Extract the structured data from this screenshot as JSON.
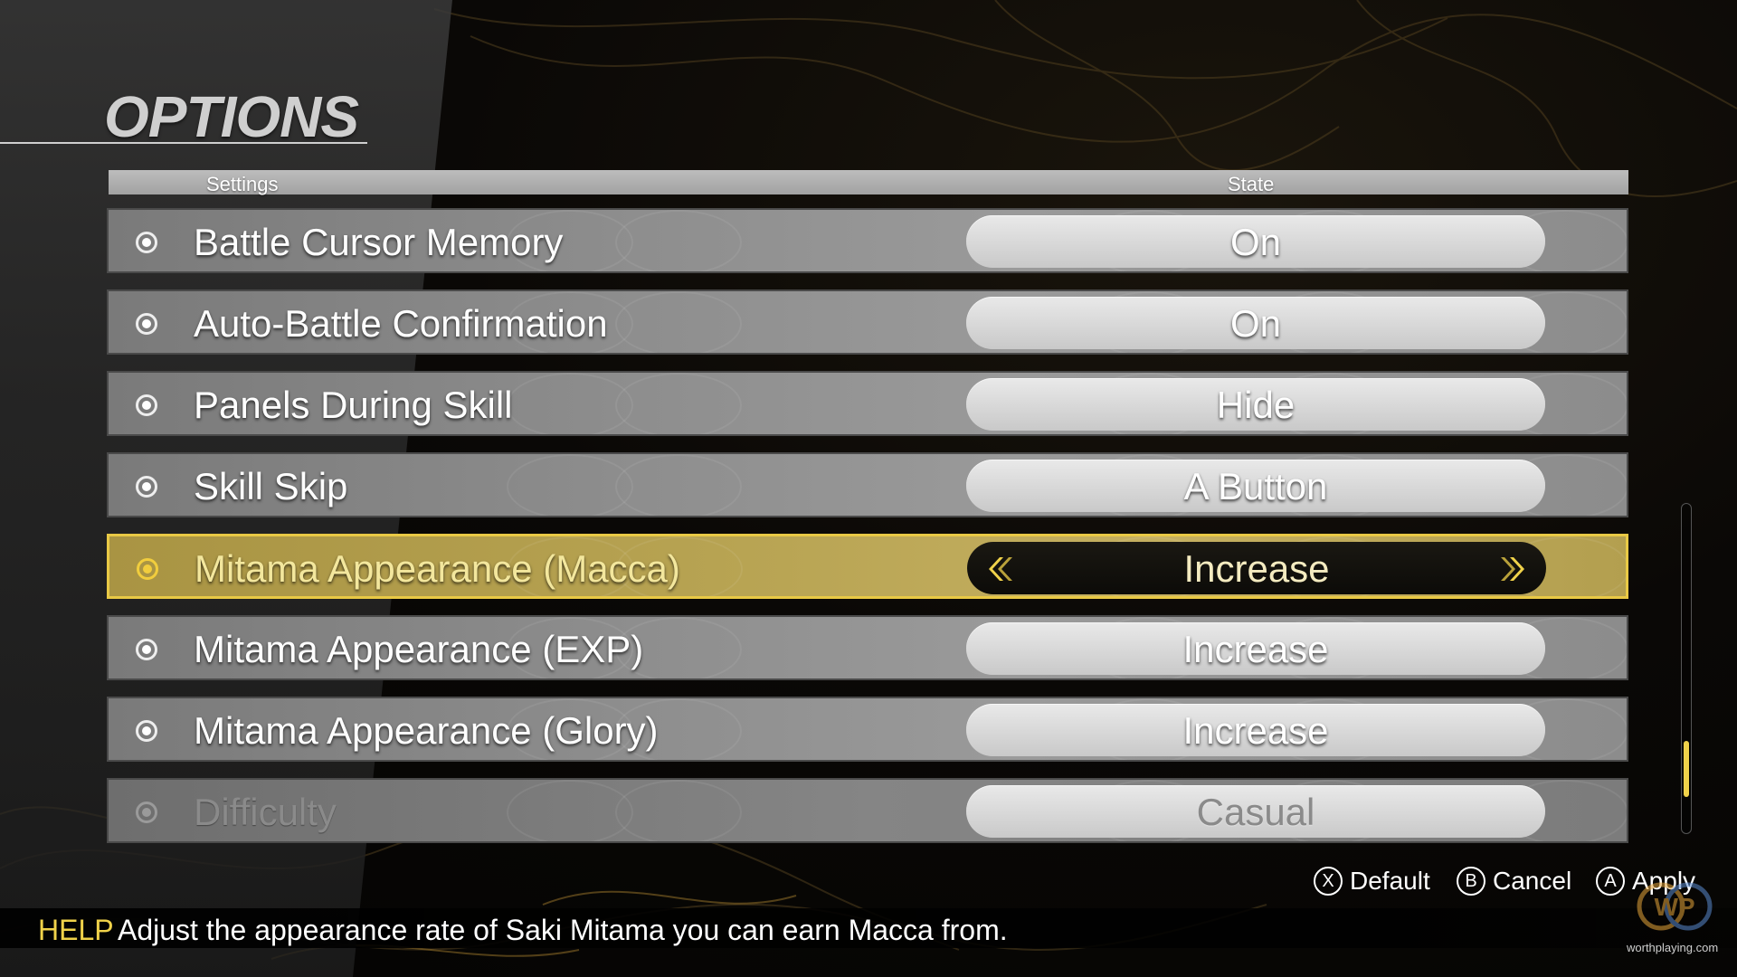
{
  "screen": {
    "title": "OPTIONS"
  },
  "table_header": {
    "settings_label": "Settings",
    "state_label": "State"
  },
  "options": [
    {
      "label": "Battle Cursor Memory",
      "value": "On",
      "state": "normal"
    },
    {
      "label": "Auto-Battle Confirmation",
      "value": "On",
      "state": "normal"
    },
    {
      "label": "Panels During Skill",
      "value": "Hide",
      "state": "normal"
    },
    {
      "label": "Skill Skip",
      "value": "A Button",
      "state": "normal"
    },
    {
      "label": "Mitama Appearance (Macca)",
      "value": "Increase",
      "state": "selected"
    },
    {
      "label": "Mitama Appearance (EXP)",
      "value": "Increase",
      "state": "normal"
    },
    {
      "label": "Mitama Appearance (Glory)",
      "value": "Increase",
      "state": "normal"
    },
    {
      "label": "Difficulty",
      "value": "Casual",
      "state": "disabled"
    }
  ],
  "scrollbar": {
    "thumb_position_fraction": 0.72,
    "thumb_size_fraction": 0.17
  },
  "actions": [
    {
      "button": "X",
      "label": "Default"
    },
    {
      "button": "B",
      "label": "Cancel"
    },
    {
      "button": "A",
      "label": "Apply"
    }
  ],
  "help": {
    "label": "HELP",
    "text": "Adjust the appearance rate of Saki Mitama you can earn Macca from."
  },
  "watermark": {
    "text": "worthplaying.com",
    "logo_text": "WP"
  },
  "colors": {
    "accent": "#f0d24a",
    "selected_row": "#b7a352",
    "row": "#8e8e8e"
  },
  "icons": {
    "option_bullet": "radio-dot-icon",
    "value_prev": "double-chevron-left-icon",
    "value_next": "double-chevron-right-icon"
  }
}
